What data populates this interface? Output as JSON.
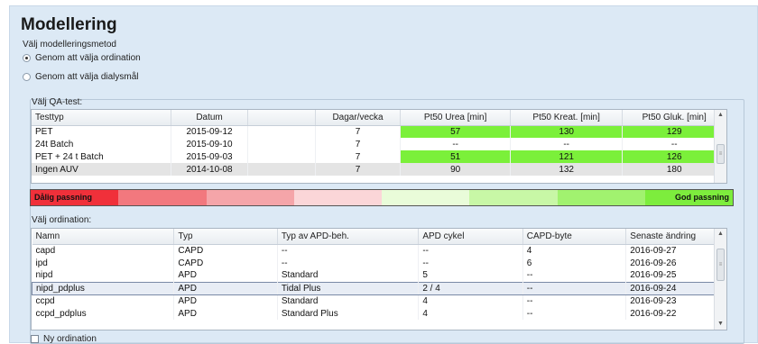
{
  "title": "Modellering",
  "method_label": "Välj modelleringsmetod",
  "radio_options": [
    {
      "label": "Genom att välja ordination",
      "selected": true
    },
    {
      "label": "Genom att välja dialysmål",
      "selected": false
    }
  ],
  "qa": {
    "label": "Välj QA-test:",
    "columns": [
      "Testtyp",
      "Datum",
      "",
      "Dagar/vecka",
      "Pt50 Urea [min]",
      "Pt50 Kreat. [min]",
      "Pt50 Gluk. [min]"
    ],
    "rows": [
      {
        "cells": [
          "PET",
          "2015-09-12",
          "",
          "7",
          "57",
          "130",
          "129"
        ],
        "green": [
          true,
          true,
          true
        ],
        "selected": false
      },
      {
        "cells": [
          "24t Batch",
          "2015-09-10",
          "",
          "7",
          "--",
          "--",
          "--"
        ],
        "green": [
          false,
          false,
          false
        ],
        "selected": false
      },
      {
        "cells": [
          "PET + 24 t Batch",
          "2015-09-03",
          "",
          "7",
          "51",
          "121",
          "126"
        ],
        "green": [
          true,
          true,
          true
        ],
        "selected": false
      },
      {
        "cells": [
          "Ingen AUV",
          "2014-10-08",
          "",
          "7",
          "90",
          "132",
          "180"
        ],
        "green": [
          false,
          false,
          false
        ],
        "selected": true
      }
    ]
  },
  "legend": {
    "left": "Dålig passning",
    "right": "God passning",
    "colors": [
      "#f0303a",
      "#f2787e",
      "#f5a5a9",
      "#fbd6d8",
      "#e9fcd9",
      "#c8f7a6",
      "#a1f26f",
      "#7ded3d"
    ]
  },
  "ord": {
    "label": "Välj ordination:",
    "columns": [
      "Namn",
      "Typ",
      "Typ av APD-beh.",
      "APD cykel",
      "CAPD-byte",
      "Senaste ändring"
    ],
    "rows": [
      {
        "cells": [
          "capd",
          "CAPD",
          "--",
          "--",
          "4",
          "2016-09-27"
        ],
        "selected": false
      },
      {
        "cells": [
          "ipd",
          "CAPD",
          "--",
          "--",
          "6",
          "2016-09-26"
        ],
        "selected": false
      },
      {
        "cells": [
          "nipd",
          "APD",
          "Standard",
          "5",
          "--",
          "2016-09-25"
        ],
        "selected": false
      },
      {
        "cells": [
          "nipd_pdplus",
          "APD",
          "Tidal Plus",
          "2 / 4",
          "--",
          "2016-09-24"
        ],
        "selected": true
      },
      {
        "cells": [
          "ccpd",
          "APD",
          "Standard",
          "4",
          "--",
          "2016-09-23"
        ],
        "selected": false
      },
      {
        "cells": [
          "ccpd_pdplus",
          "APD",
          "Standard Plus",
          "4",
          "--",
          "2016-09-22"
        ],
        "selected": false
      }
    ]
  },
  "new_ord_label": "Ny ordination"
}
